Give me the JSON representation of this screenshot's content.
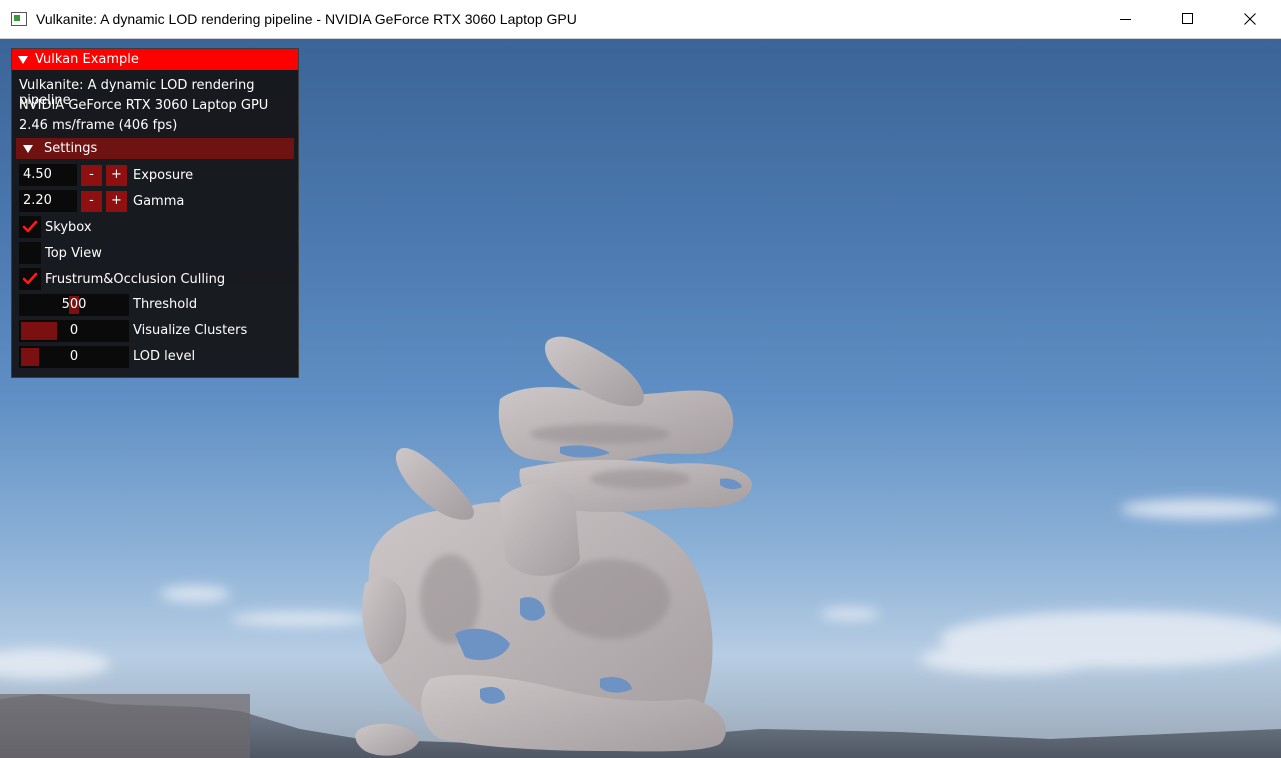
{
  "window": {
    "title": "Vulkanite: A dynamic LOD rendering pipeline - NVIDIA GeForce RTX 3060 Laptop GPU",
    "controls": [
      "minimize-icon",
      "maximize-icon",
      "close-icon"
    ]
  },
  "panel": {
    "header": "Vulkan Example",
    "info": {
      "app_name": "Vulkanite: A dynamic LOD rendering pipeline",
      "gpu": "NVIDIA GeForce RTX 3060 Laptop GPU",
      "frame_time": "2.46 ms/frame (406 fps)"
    },
    "settings": {
      "label": "Settings",
      "exposure": {
        "value": "4.50",
        "label": "Exposure",
        "minus": "-",
        "plus": "+"
      },
      "gamma": {
        "value": "2.20",
        "label": "Gamma",
        "minus": "-",
        "plus": "+"
      },
      "skybox": {
        "label": "Skybox",
        "checked": true
      },
      "top_view": {
        "label": "Top View",
        "checked": false
      },
      "culling": {
        "label": "Frustrum&Occlusion Culling",
        "checked": true
      },
      "threshold": {
        "value": "500",
        "label": "Threshold",
        "fraction": 0.5
      },
      "visualize_clusters": {
        "value": "0",
        "label": "Visualize Clusters",
        "fraction": 0.0
      },
      "lod_level": {
        "value": "0",
        "label": "LOD level",
        "fraction": 0.0
      }
    }
  },
  "colors": {
    "header_red": "#ff0000",
    "section_red": "#6e1212",
    "button_red": "#8e1010",
    "check_red": "#ff1a1a",
    "model_color": "#b9b3b4"
  }
}
